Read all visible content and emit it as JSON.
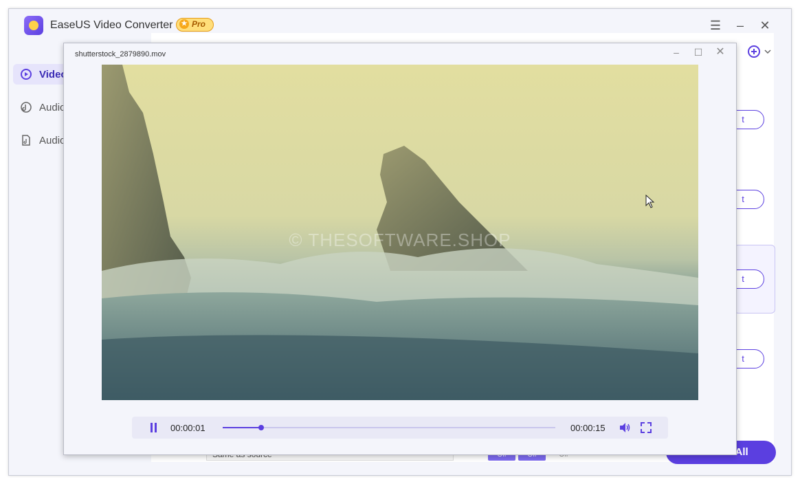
{
  "app": {
    "title": "EaseUS Video Converter",
    "badge": "Pro",
    "menu_icon": "hamburger-icon",
    "minimize_icon": "minimize-icon",
    "close_icon": "close-icon"
  },
  "sidebar": {
    "items": [
      {
        "label": "Video",
        "icon": "video-convert-icon",
        "active": true
      },
      {
        "label": "Audio",
        "icon": "audio-convert-icon",
        "active": false
      },
      {
        "label": "Audio",
        "icon": "audio-file-icon",
        "active": false
      }
    ]
  },
  "main": {
    "row_button_label": "t",
    "bottom": {
      "format_value": "Same as source",
      "toggle1": "Off",
      "toggle2": "Off",
      "toggle3": "Off",
      "convert_all": "Convert All"
    }
  },
  "player": {
    "filename": "shutterstock_2879890.mov",
    "watermark": "© THESOFTWARE.SHOP",
    "current_time": "00:00:01",
    "total_time": "00:00:15",
    "progress_fraction": 0.116
  },
  "colors": {
    "accent": "#5b3fe0",
    "badge_fill": "#ffde7a"
  }
}
